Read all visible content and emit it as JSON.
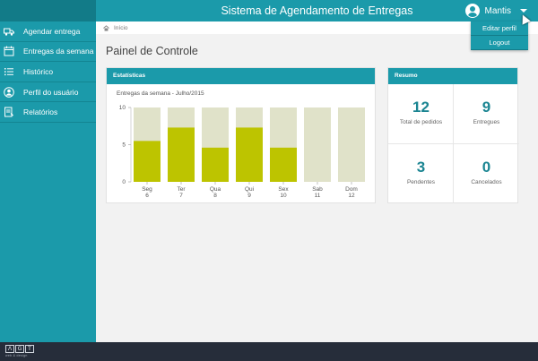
{
  "header": {
    "title": "Sistema de Agendamento de Entregas",
    "user_name": "Mantis"
  },
  "user_menu": {
    "items": [
      "Editar perfil",
      "Logout"
    ]
  },
  "sidebar": {
    "items": [
      {
        "label": "Agendar entrega",
        "icon": "truck-icon"
      },
      {
        "label": "Entregas da semana",
        "icon": "calendar-icon"
      },
      {
        "label": "Histórico",
        "icon": "list-icon"
      },
      {
        "label": "Perfil do usuário",
        "icon": "user-icon"
      },
      {
        "label": "Relatórios",
        "icon": "report-icon"
      }
    ]
  },
  "breadcrumb": {
    "home": "Início"
  },
  "page": {
    "title": "Painel de Controle"
  },
  "stats": {
    "heading": "Estatísticas",
    "subtitle": "Entregas da semana - Julho/2015"
  },
  "chart_data": {
    "type": "bar",
    "title": "Entregas da semana - Julho/2015",
    "categories": [
      "Seg",
      "Ter",
      "Qua",
      "Qui",
      "Sex",
      "Sab",
      "Dom"
    ],
    "dates": [
      "6",
      "7",
      "8",
      "9",
      "10",
      "11",
      "12"
    ],
    "values": [
      5.5,
      7.3,
      4.6,
      7.3,
      4.6,
      0,
      0
    ],
    "background_max": 10,
    "ylim": [
      0,
      10
    ],
    "yticks": [
      0,
      5,
      10
    ],
    "colors": {
      "bar": "#bdc400",
      "track": "#e0e2c9"
    }
  },
  "resumo": {
    "heading": "Resumo",
    "cells": [
      {
        "value": "12",
        "label": "Total de pedidos"
      },
      {
        "value": "9",
        "label": "Entregues"
      },
      {
        "value": "3",
        "label": "Pendentes"
      },
      {
        "value": "0",
        "label": "Cancelados"
      }
    ]
  },
  "footer": {
    "logo_letters": [
      "Λ",
      "G",
      "T"
    ],
    "logo_tagline": "web & design"
  },
  "colors": {
    "accent": "#1b9aaa",
    "dark": "#127b88",
    "footer": "#262d3a"
  }
}
